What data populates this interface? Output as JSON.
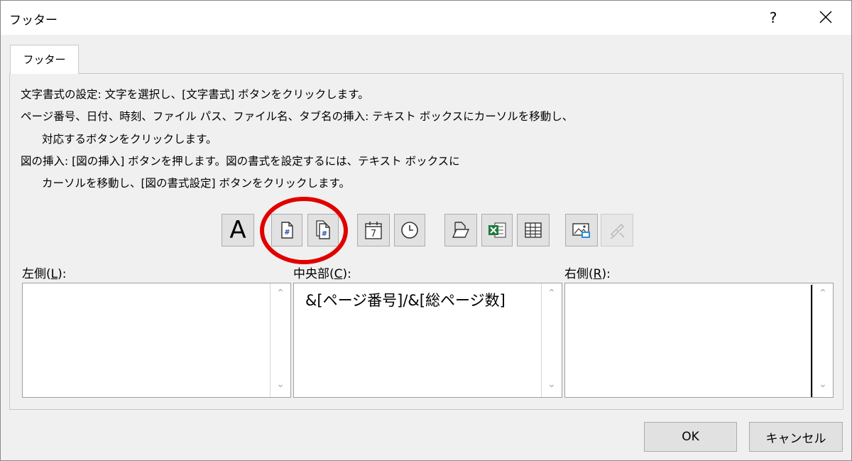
{
  "window": {
    "title": "フッター",
    "help_label": "?"
  },
  "tab": {
    "label": "フッター"
  },
  "instructions": [
    "文字書式の設定: 文字を選択し、[文字書式] ボタンをクリックします。",
    "ページ番号、日付、時刻、ファイル パス、ファイル名、タブ名の挿入: テキスト ボックスにカーソルを移動し、",
    "対応するボタンをクリックします。",
    "図の挿入: [図の挿入] ボタンを押します。図の書式を設定するには、テキスト ボックスに",
    "カーソルを移動し、[図の書式設定] ボタンをクリックします。"
  ],
  "toolbar": {
    "format_text_glyph": "A",
    "date_glyph": "7",
    "buttons": [
      {
        "icon": "format-text-icon"
      },
      {
        "icon": "page-number-icon"
      },
      {
        "icon": "total-pages-icon"
      },
      {
        "icon": "date-icon"
      },
      {
        "icon": "time-icon"
      },
      {
        "icon": "file-path-icon"
      },
      {
        "icon": "file-name-icon"
      },
      {
        "icon": "sheet-name-icon"
      },
      {
        "icon": "insert-picture-icon"
      },
      {
        "icon": "format-picture-icon",
        "enabled": false
      }
    ],
    "highlight_color": "#e10000"
  },
  "sections": {
    "left": {
      "label_pre": "左側(",
      "label_key": "L",
      "label_post": "):",
      "value": ""
    },
    "center": {
      "label_pre": "中央部(",
      "label_key": "C",
      "label_post": "):",
      "value": "&[ページ番号]/&[総ページ数]"
    },
    "right": {
      "label_pre": "右側(",
      "label_key": "R",
      "label_post": "):",
      "value": ""
    }
  },
  "buttons": {
    "ok": "OK",
    "cancel": "キャンセル"
  }
}
